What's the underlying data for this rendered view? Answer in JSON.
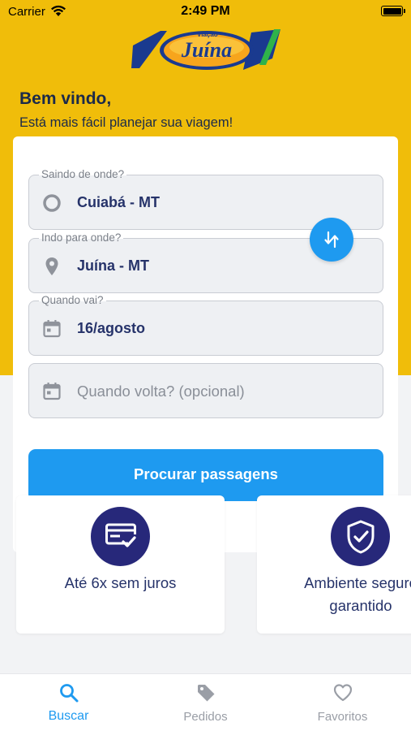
{
  "status_bar": {
    "carrier": "Carrier",
    "time": "2:49 PM"
  },
  "logo": {
    "brand_small": "Viação",
    "brand": "Juína"
  },
  "header": {
    "greeting": "Bem vindo,",
    "subtitle": "Está mais fácil planejar sua viagem!"
  },
  "form": {
    "origin": {
      "label": "Saindo de onde?",
      "value": "Cuiabá - MT"
    },
    "destination": {
      "label": "Indo para onde?",
      "value": "Juína - MT"
    },
    "departure": {
      "label": "Quando vai?",
      "value": "16/agosto"
    },
    "return": {
      "placeholder": "Quando volta? (opcional)"
    },
    "search_button": "Procurar passagens"
  },
  "features": [
    {
      "icon": "card-check-icon",
      "line1": "Até 6x sem juros",
      "line2": ""
    },
    {
      "icon": "shield-check-icon",
      "line1": "Ambiente seguro",
      "line2": "garantido"
    }
  ],
  "tabs": [
    {
      "label": "Buscar",
      "icon": "search-icon",
      "active": true
    },
    {
      "label": "Pedidos",
      "icon": "tag-icon",
      "active": false
    },
    {
      "label": "Favoritos",
      "icon": "heart-icon",
      "active": false
    }
  ],
  "colors": {
    "header_yellow": "#f0bd0a",
    "primary_blue": "#1e9af0",
    "navy": "#27287a",
    "text_dark": "#26336a",
    "tab_inactive": "#9a9ea6"
  }
}
